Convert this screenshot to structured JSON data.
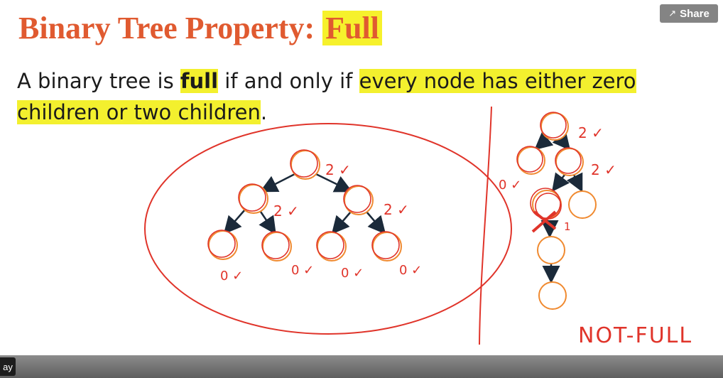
{
  "slide": {
    "title_prefix": "Binary Tree Property: ",
    "title_highlight": "Full",
    "definition": {
      "part1": "A binary tree is ",
      "bold": "full",
      "part2": " if and only if ",
      "highlight1": "every node has either zero",
      "highlight2": "children or two children",
      "end": "."
    }
  },
  "annotations": {
    "full_tree": {
      "root_mark": "2 ✓",
      "left_mark": "2 ✓",
      "right_mark": "2 ✓",
      "leaf_marks": [
        "0 ✓",
        "0 ✓",
        "0 ✓",
        "0 ✓"
      ]
    },
    "not_full_tree": {
      "root_mark": "2 ✓",
      "left_mark": "0 ✓",
      "right_mark": "2 ✓",
      "bad_mark": "1",
      "label": "NOT-FULL"
    }
  },
  "player": {
    "share_label": "Share",
    "play_label": "ay"
  },
  "colors": {
    "title": "#e05a30",
    "highlight": "#f3f02e",
    "ink": "#e0342a",
    "node": "#f08a30"
  }
}
